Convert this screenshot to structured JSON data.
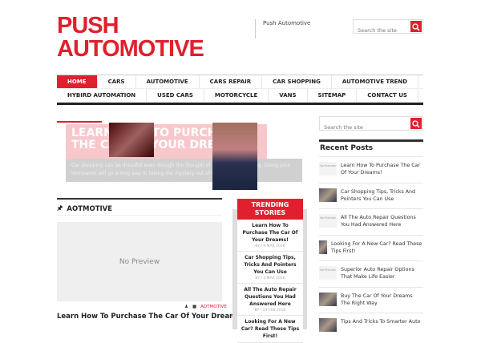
{
  "header": {
    "logo_line1": "PUSH",
    "logo_line2": "AUTOMOTIVE",
    "tagline": "Push Automotive",
    "search_placeholder": "Search the site"
  },
  "nav": {
    "row1": [
      "HOME",
      "CARS",
      "AUTOMOTIVE",
      "CARS REPAIR",
      "CAR SHOPPING",
      "AUTOMOTIVE TREND"
    ],
    "row2": [
      "HYBIRD AUTOMATION",
      "USED CARS",
      "MOTORCYCLE",
      "VANS",
      "SITEMAP",
      "CONTACT US"
    ],
    "active": "HOME"
  },
  "slider": {
    "title": "LEARN HOW TO PURCHASE THE CAR OF YOUR DREAMS",
    "excerpt": "Car shopping can be dreadful even though the thought of a new car is exciting. Doing your homework will go a long way in taking the mystery out of the"
  },
  "sidebar": {
    "search_placeholder": "Search the site",
    "recent_title": "Recent Posts",
    "no_preview": "No Preview",
    "recent": [
      {
        "title": "Learn How To Purchase The Car Of Your Dreams!",
        "thumb": "none"
      },
      {
        "title": "Car Shopping Tips, Tricks And Pointers You Can Use",
        "thumb": "image"
      },
      {
        "title": "All The Auto Repair Questions You Had Answered Here",
        "thumb": "none"
      },
      {
        "title": "Looking For A New Car? Read These Tips First!",
        "thumb": "small"
      },
      {
        "title": "Superior Auto Repair Options That Make Life Easier",
        "thumb": "none"
      },
      {
        "title": "Buy The Car Of Your Dreams The Right Way",
        "thumb": "image"
      },
      {
        "title": "Tips And Tricks To Smarter Auto",
        "thumb": "image"
      }
    ]
  },
  "section": {
    "title": "AOTMOTIVE",
    "no_preview": "No Preview",
    "category": "AOTMOTIVE",
    "post_title": "Learn How To Purchase The Car Of Your Dreams!"
  },
  "trending": {
    "title": "TRENDING STORIES",
    "items": [
      {
        "title": "Learn How To Purchase The Car Of Your Dreams!",
        "date": "BY / 9 MAR 2016"
      },
      {
        "title": "Car Shopping Tips, Tricks And Pointers You Can Use",
        "date": "BY / 2 MAR 2016"
      },
      {
        "title": "All The Auto Repair Questions You Had Answered Here",
        "date": "BY / 24 FEB 2016"
      },
      {
        "title": "Looking For A New Car? Read These Tips First!",
        "date": ""
      }
    ]
  },
  "colors": {
    "accent": "#e0202e"
  }
}
